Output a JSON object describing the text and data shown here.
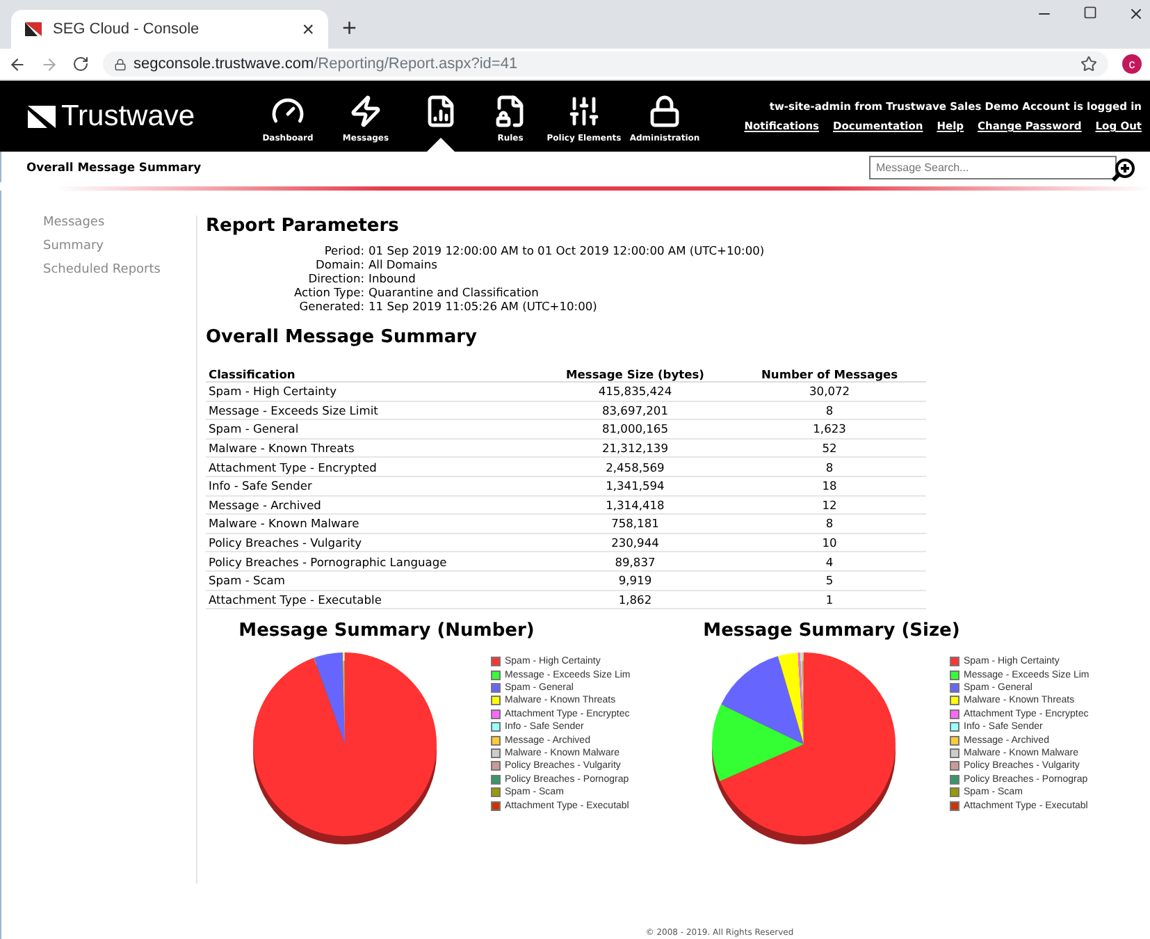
{
  "browser": {
    "tab_title": "SEG Cloud - Console",
    "tab_close": "×",
    "new_tab": "+",
    "url_host": "segconsole.trustwave.com",
    "url_path": "/Reporting/Report.aspx?id=41",
    "profile_initial": "c"
  },
  "header": {
    "logo": "Trustwave",
    "nav": [
      {
        "kind": "gauge",
        "label": "Dashboard",
        "selected": false
      },
      {
        "kind": "bolt",
        "label": "Messages",
        "selected": false
      },
      {
        "kind": "report",
        "selected": true
      },
      {
        "kind": "rules",
        "label": "Rules",
        "selected": false
      },
      {
        "kind": "sliders",
        "label": "Policy Elements",
        "selected": false
      },
      {
        "kind": "lock",
        "label": "Administration",
        "selected": false
      }
    ],
    "login_text": "tw-site-admin from Trustwave Sales Demo Account is logged in",
    "links": [
      "Notifications",
      "Documentation",
      "Help",
      "Change Password",
      "Log Out"
    ]
  },
  "subheader": {
    "title": "Overall Message Summary",
    "search": {
      "placeholder": "Message Search..."
    }
  },
  "sidebar": {
    "items": [
      "Messages",
      "Summary",
      "Scheduled Reports"
    ]
  },
  "report_parameters": {
    "heading": "Report Parameters",
    "params": [
      {
        "label": "Period:",
        "value": "01 Sep 2019 12:00:00 AM to 01 Oct 2019 12:00:00 AM (UTC+10:00)"
      },
      {
        "label": "Domain:",
        "value": "All Domains"
      },
      {
        "label": "Direction:",
        "value": "Inbound"
      },
      {
        "label": "Action Type:",
        "value": "Quarantine and Classification"
      },
      {
        "label": "Generated:",
        "value": "11 Sep 2019 11:05:26 AM (UTC+10:00)"
      }
    ]
  },
  "summary": {
    "heading": "Overall Message Summary",
    "table": {
      "columns": [
        "Classification",
        "Message Size (bytes)",
        "Number of Messages"
      ],
      "rows": [
        [
          "Spam - High Certainty",
          "415,835,424",
          "30,072"
        ],
        [
          "Message - Exceeds Size Limit",
          "83,697,201",
          "8"
        ],
        [
          "Spam - General",
          "81,000,165",
          "1,623"
        ],
        [
          "Malware - Known Threats",
          "21,312,139",
          "52"
        ],
        [
          "Attachment Type - Encrypted",
          "2,458,569",
          "8"
        ],
        [
          "Info - Safe Sender",
          "1,341,594",
          "18"
        ],
        [
          "Message - Archived",
          "1,314,418",
          "12"
        ],
        [
          "Malware - Known Malware",
          "758,181",
          "8"
        ],
        [
          "Policy Breaches - Vulgarity",
          "230,944",
          "10"
        ],
        [
          "Policy Breaches - Pornographic Language",
          "89,837",
          "4"
        ],
        [
          "Spam - Scam",
          "9,919",
          "5"
        ],
        [
          "Attachment Type - Executable",
          "1,862",
          "1"
        ]
      ]
    }
  },
  "charts": [
    {
      "title": "Message Summary (Number)",
      "kind": "pie",
      "legend": [
        {
          "label": "Spam - High Certainty",
          "color": "#ff3333"
        },
        {
          "label": "Message - Exceeds Size Lim",
          "color": "#33ff33"
        },
        {
          "label": "Spam - General",
          "color": "#6666ff"
        },
        {
          "label": "Malware - Known Threats",
          "color": "#ffff00"
        },
        {
          "label": "Attachment Type - Encryptec",
          "color": "#ff66ff"
        },
        {
          "label": "Info - Safe Sender",
          "color": "#99ffff"
        },
        {
          "label": "Message - Archived",
          "color": "#ffcc33"
        },
        {
          "label": "Malware - Known Malware",
          "color": "#cccccc"
        },
        {
          "label": "Policy Breaches - Vulgarity",
          "color": "#cc9999"
        },
        {
          "label": "Policy Breaches - Pornograp",
          "color": "#339966"
        },
        {
          "label": "Spam - Scam",
          "color": "#999900"
        },
        {
          "label": "Attachment Type - Executabl",
          "color": "#cc3300"
        }
      ]
    },
    {
      "title": "Message Summary (Size)",
      "kind": "pie",
      "legend": [
        {
          "label": "Spam - High Certainty",
          "color": "#ff3333"
        },
        {
          "label": "Message - Exceeds Size Lim",
          "color": "#33ff33"
        },
        {
          "label": "Spam - General",
          "color": "#6666ff"
        },
        {
          "label": "Malware - Known Threats",
          "color": "#ffff00"
        },
        {
          "label": "Attachment Type - Encryptec",
          "color": "#ff66ff"
        },
        {
          "label": "Info - Safe Sender",
          "color": "#99ffff"
        },
        {
          "label": "Message - Archived",
          "color": "#ffcc33"
        },
        {
          "label": "Malware - Known Malware",
          "color": "#cccccc"
        },
        {
          "label": "Policy Breaches - Vulgarity",
          "color": "#cc9999"
        },
        {
          "label": "Policy Breaches - Pornograp",
          "color": "#339966"
        },
        {
          "label": "Spam - Scam",
          "color": "#999900"
        },
        {
          "label": "Attachment Type - Executabl",
          "color": "#cc3300"
        }
      ]
    }
  ],
  "footer": "© 2008 - 2019. All Rights Reserved"
}
